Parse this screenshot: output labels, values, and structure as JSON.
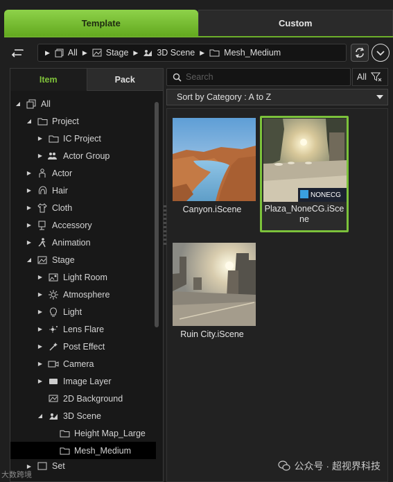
{
  "tabs": {
    "template": "Template",
    "custom": "Custom"
  },
  "breadcrumb": {
    "all": "All",
    "stage": "Stage",
    "scene": "3D Scene",
    "mesh": "Mesh_Medium"
  },
  "left_tabs": {
    "item": "Item",
    "pack": "Pack"
  },
  "tree": {
    "all": "All",
    "project": "Project",
    "ic_project": "IC Project",
    "actor_group": "Actor Group",
    "actor": "Actor",
    "hair": "Hair",
    "cloth": "Cloth",
    "accessory": "Accessory",
    "animation": "Animation",
    "stage": "Stage",
    "light_room": "Light Room",
    "atmosphere": "Atmosphere",
    "light": "Light",
    "lens_flare": "Lens Flare",
    "post_effect": "Post Effect",
    "camera": "Camera",
    "image_layer": "Image Layer",
    "bg_2d": "2D Background",
    "scene_3d": "3D Scene",
    "height_map": "Height Map_Large",
    "mesh_medium": "Mesh_Medium",
    "set": "Set"
  },
  "search": {
    "placeholder": "Search",
    "filter": "All"
  },
  "sort": {
    "label": "Sort by Category : A to Z"
  },
  "items": [
    {
      "label": "Canyon.iScene"
    },
    {
      "label": "Plaza_NoneCG.iScene"
    },
    {
      "label": "Ruin City.iScene"
    }
  ],
  "plaza_label_line1": "Plaza_NoneCG.iSce",
  "plaza_label_line2": "ne",
  "brand_logo": "NONECG",
  "watermark": "公众号 · 超视界科技",
  "watermark2": "大数跨境",
  "colors": {
    "accent": "#7cc23b",
    "tab_active": "#63a91f"
  }
}
